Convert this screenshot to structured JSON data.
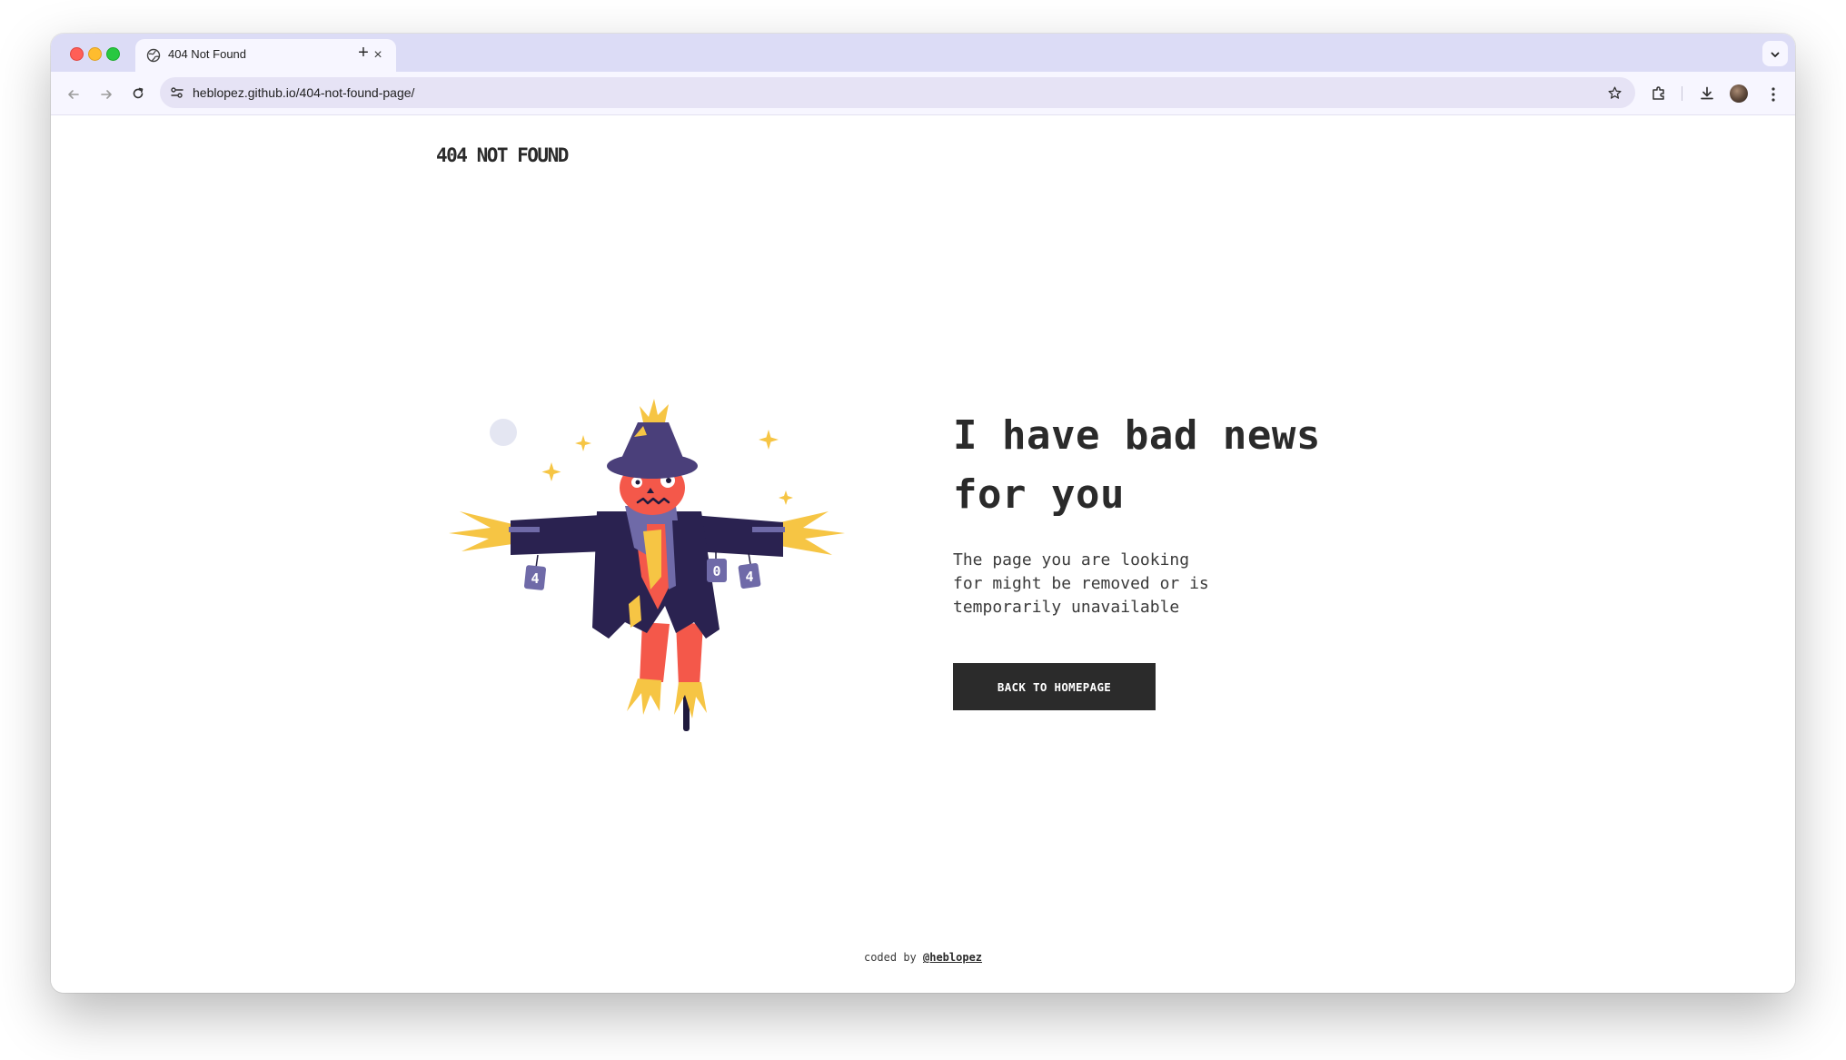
{
  "browser": {
    "tab_title": "404 Not Found",
    "tab_close_label": "×",
    "new_tab_label": "+",
    "url": "heblopez.github.io/404-not-found-page/"
  },
  "page": {
    "brand": "404 NOT FOUND",
    "headline_line1": "I have bad news",
    "headline_line2": "for you",
    "subtext": "The page you are looking\nfor might be removed or is\ntemporarily unavailable",
    "cta_label": "BACK TO HOMEPAGE",
    "footer_prefix": "coded by ",
    "footer_link": "@heblopez",
    "scarecrow_tags": [
      "4",
      "0",
      "4"
    ]
  },
  "colors": {
    "tabstrip": "#dcdcf6",
    "toolbar": "#f7f6ff",
    "button_bg": "#2b2b2b",
    "hat": "#4a3f7a",
    "face": "#f4584a",
    "straw": "#f6c544",
    "coat": "#2a2250",
    "tag": "#6f6aa8"
  }
}
